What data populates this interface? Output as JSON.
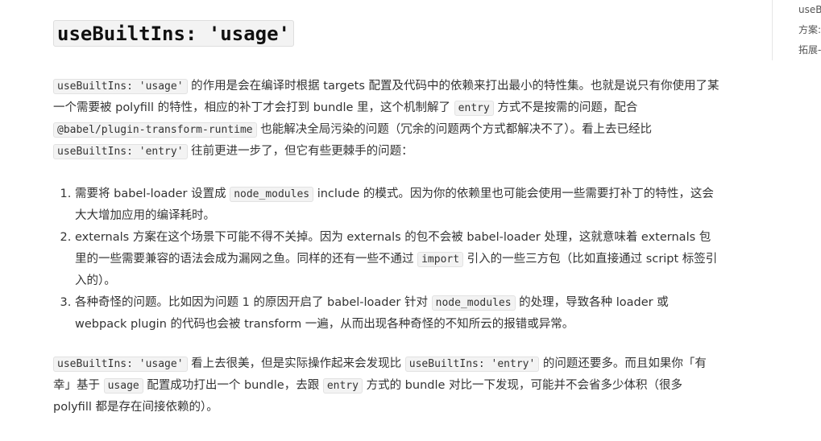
{
  "heading": "useBuiltIns: 'usage'",
  "paragraph1": {
    "code1": "useBuiltIns: 'usage'",
    "text1": " 的作用是会在编译时根据 targets 配置及代码中的依赖来打出最小的特性集。也就是说只有你使用了某一个需要被 polyfill 的特性，相应的补丁才会打到 bundle 里，这个机制解了 ",
    "code2": "entry",
    "text2": " 方式不是按需的问题，配合 ",
    "code3": "@babel/plugin-transform-runtime",
    "text3": " 也能解决全局污染的问题（冗余的问题两个方式都解决不了）。看上去已经比 ",
    "code4": "useBuiltIns: 'entry'",
    "text4": " 往前更进一步了，但它有些更棘手的问题："
  },
  "list": [
    {
      "text1": "需要将 babel-loader 设置成 ",
      "code1": "node_modules",
      "text2": " include 的模式。因为你的依赖里也可能会使用一些需要打补丁的特性，这会大大增加应用的编译耗时。"
    },
    {
      "text1": "externals 方案在这个场景下可能不得不关掉。因为 externals 的包不会被 babel-loader 处理，这就意味着 externals 包里的一些需要兼容的语法会成为漏网之鱼。同样的还有一些不通过 ",
      "code1": "import",
      "text2": " 引入的一些三方包（比如直接通过 script 标签引入的）。"
    },
    {
      "text1": "各种奇怪的问题。比如因为问题 1 的原因开启了 babel-loader 针对 ",
      "code1": "node_modules",
      "text2": " 的处理，导致各种 loader 或 webpack plugin 的代码也会被 transform 一遍，从而出现各种奇怪的不知所云的报错或异常。"
    }
  ],
  "paragraph2": {
    "code1": "useBuiltIns: 'usage'",
    "text1": " 看上去很美，但是实际操作起来会发现比 ",
    "code2": "useBuiltIns: 'entry'",
    "text2": " 的问题还要多。而且如果你「有幸」基于 ",
    "code3": "usage",
    "text3": " 配置成功打出一个 bundle，去跟 ",
    "code4": "entry",
    "text4": " 方式的 bundle 对比一下发现，可能并不会省多少体积（很多 polyfill 都是存在间接依赖的）。"
  },
  "toc": {
    "items": [
      "useB",
      "方案:",
      "拓展-"
    ]
  }
}
